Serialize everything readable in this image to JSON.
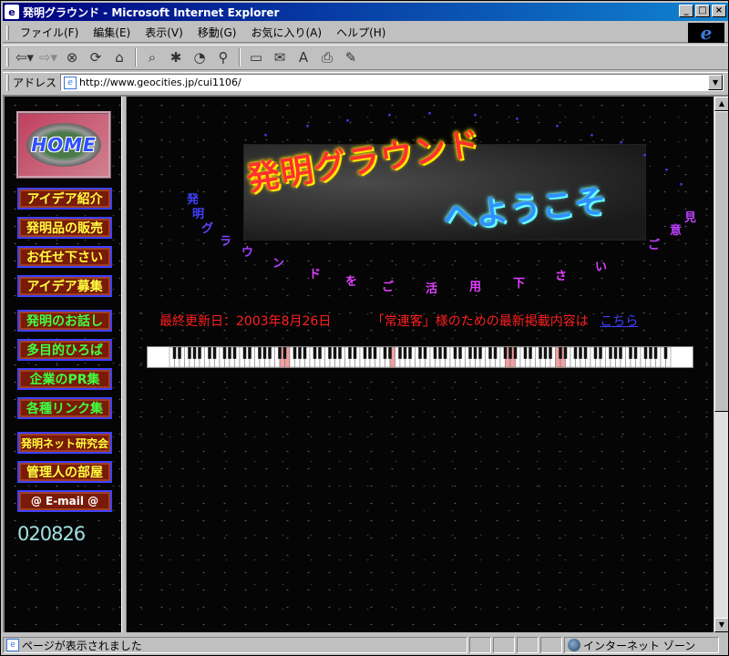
{
  "window": {
    "title": "発明グラウンド - Microsoft Internet Explorer",
    "controls": {
      "minimize": "_",
      "maximize": "□",
      "close": "×"
    }
  },
  "menu": [
    "ファイル(F)",
    "編集(E)",
    "表示(V)",
    "移動(G)",
    "お気に入り(A)",
    "ヘルプ(H)"
  ],
  "toolbar": {
    "icons": [
      "back-icon",
      "forward-icon",
      "stop-icon",
      "refresh-icon",
      "home-icon",
      "search-icon",
      "favorites-icon",
      "history-icon",
      "channels-icon",
      "fullscreen-icon",
      "mail-icon",
      "font-icon",
      "print-icon",
      "edit-icon"
    ]
  },
  "address": {
    "label": "アドレス",
    "url": "http://www.geocities.jp/cui1106/"
  },
  "sidebar": {
    "home_label": "HOME",
    "items": [
      {
        "label": "アイデア紹介",
        "color": "#ffff40"
      },
      {
        "label": "発明品の販売",
        "color": "#ffff40"
      },
      {
        "label": "お任せ下さい",
        "color": "#ffff40"
      },
      {
        "label": "アイデア募集",
        "color": "#ffff40"
      },
      {
        "label": "発明のお話し",
        "color": "#40ff40"
      },
      {
        "label": "多目的ひろば",
        "color": "#40ff40"
      },
      {
        "label": "企業のPR集",
        "color": "#40ff40"
      },
      {
        "label": "各種リンク集",
        "color": "#40ff40"
      },
      {
        "label": "発明ネット研究会",
        "color": "#ffff40"
      },
      {
        "label": "管理人の部屋",
        "color": "#ffff40"
      },
      {
        "label": "@ E-mail @",
        "color": "#ffffff"
      }
    ],
    "counter": "020826"
  },
  "main": {
    "banner_line1": "発明グラウンド",
    "banner_line2": "へようこそ",
    "arc_text_1": "発明グラウンドをご活用下さい。",
    "arc_text_2": "ご意見",
    "updated": "最終更新日：2003年8月26日",
    "regulars_text": "「常連客」様のための最新掲載内容は",
    "regulars_link": "こちら"
  },
  "status": {
    "text": "ページが表示されました",
    "zone": "インターネット ゾーン"
  }
}
